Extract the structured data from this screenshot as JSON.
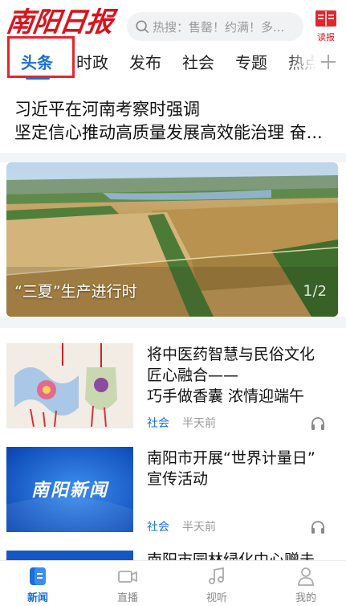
{
  "header": {
    "logo_text": "南阳日报",
    "search_placeholder": "热搜：售罄！约满！多...",
    "reader_label": "读报"
  },
  "tabs": [
    {
      "label": "头条",
      "active": true
    },
    {
      "label": "时政",
      "active": false
    },
    {
      "label": "发布",
      "active": false
    },
    {
      "label": "社会",
      "active": false
    },
    {
      "label": "专题",
      "active": false
    },
    {
      "label": "热点",
      "active": false
    }
  ],
  "headline": {
    "line1": "习近平在河南考察时强调",
    "line2": "坚定信心推动高质量发展高效能治理 奋..."
  },
  "carousel": {
    "caption": "“三夏”生产进行时",
    "current": "1",
    "total": "2"
  },
  "news": [
    {
      "title_lines": [
        "将中医药智慧与民俗文化",
        "匠心融合——",
        "巧手做香囊 浓情迎端午"
      ],
      "category": "社会",
      "time": "半天前",
      "thumb": "sachet-image"
    },
    {
      "title_lines": [
        "南阳市开展“世界计量日”",
        "宣传活动"
      ],
      "category": "社会",
      "time": "半天前",
      "thumb": "nanyang-news-logo",
      "thumb_text": "南阳新闻"
    },
    {
      "title_lines": [
        "南阳市园林绿化中心赠击"
      ],
      "category": "",
      "time": "",
      "thumb": "blue-banner"
    }
  ],
  "bottom_nav": [
    {
      "label": "新闻",
      "icon": "news-icon",
      "active": true
    },
    {
      "label": "直播",
      "icon": "video-icon",
      "active": false
    },
    {
      "label": "视听",
      "icon": "music-icon",
      "active": false
    },
    {
      "label": "我的",
      "icon": "user-icon",
      "active": false
    }
  ],
  "colors": {
    "accent": "#1a6fd8",
    "brand_red": "#d8141c",
    "highlight_box": "#e2262e"
  }
}
